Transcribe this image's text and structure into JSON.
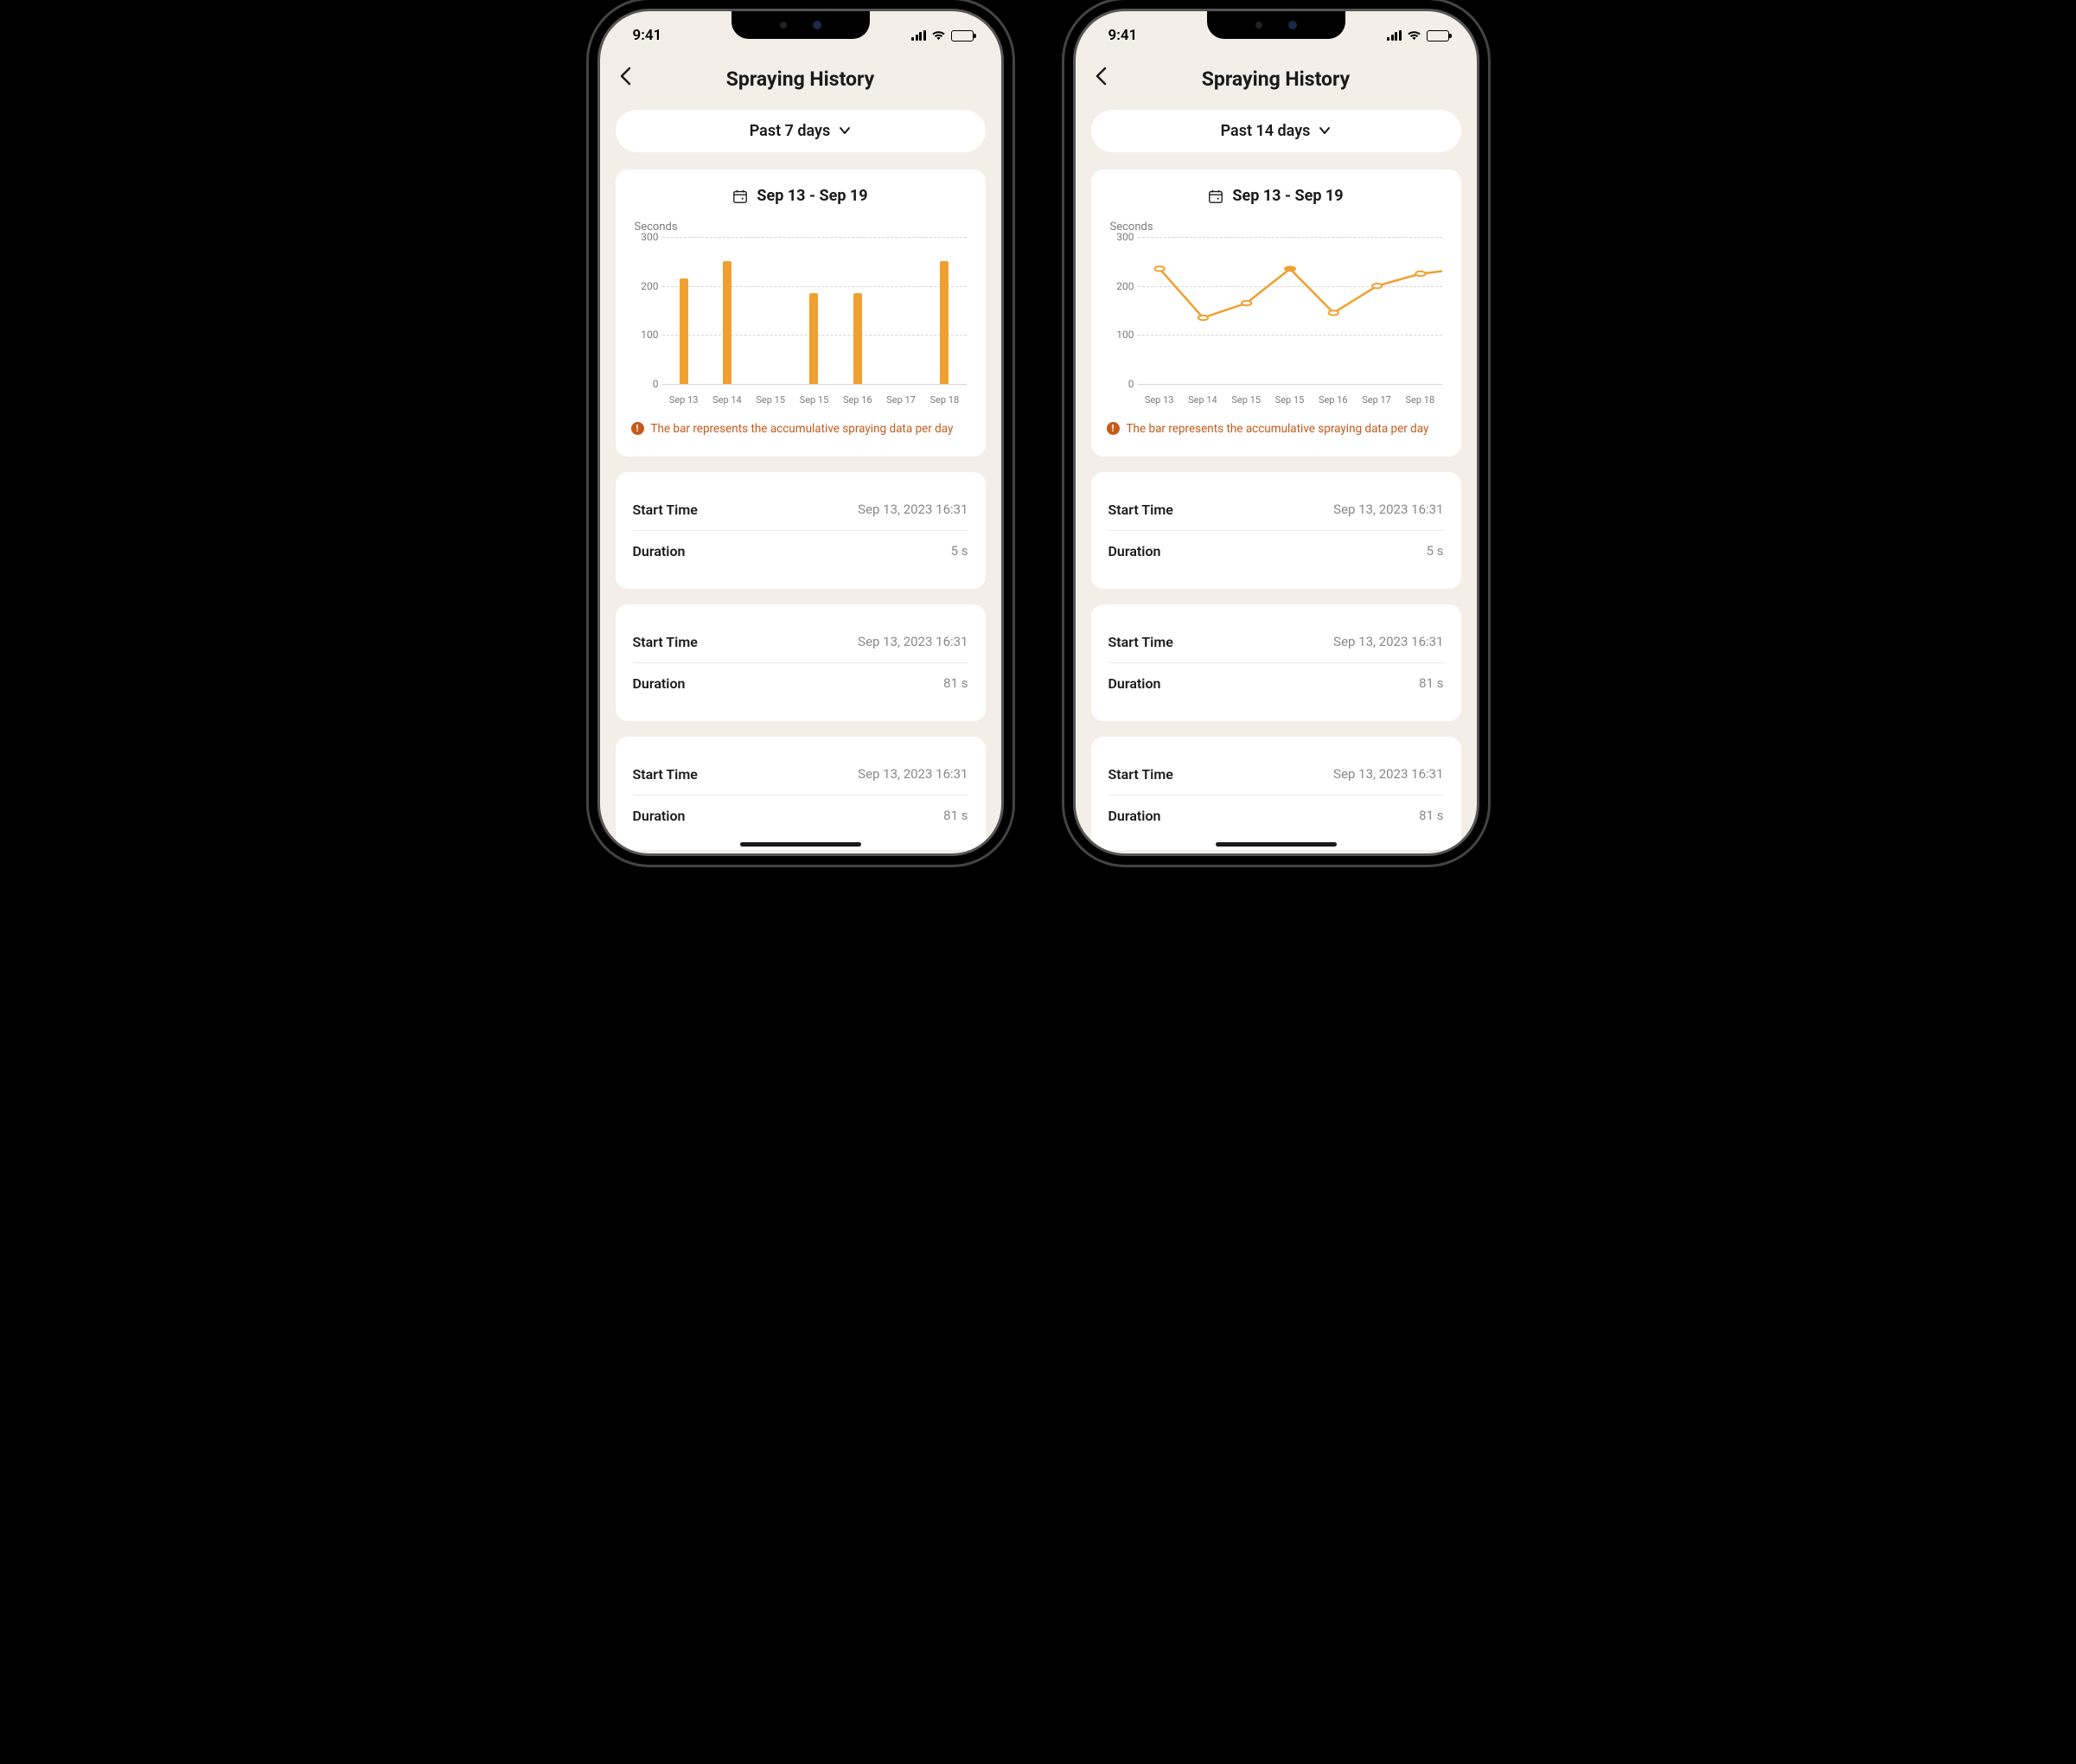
{
  "status": {
    "time": "9:41"
  },
  "header": {
    "title": "Spraying History"
  },
  "screens": [
    {
      "dropdown": "Past 7 days"
    },
    {
      "dropdown": "Past 14 days"
    }
  ],
  "chart_range": "Sep 13 - Sep 19",
  "chart_ylabel": "Seconds",
  "chart_note": "The bar represents the accumulative spraying data per day",
  "chart_data": [
    {
      "type": "bar",
      "title": "Sep 13 - Sep 19",
      "ylabel": "Seconds",
      "ylim": [
        0,
        300
      ],
      "yticks": [
        0,
        100,
        200,
        300
      ],
      "categories": [
        "Sep 13",
        "Sep 14",
        "Sep 15",
        "Sep 15",
        "Sep 16",
        "Sep 17",
        "Sep 18"
      ],
      "values": [
        215,
        250,
        0,
        185,
        185,
        0,
        250
      ]
    },
    {
      "type": "line",
      "title": "Sep 13 - Sep 19",
      "ylabel": "Seconds",
      "ylim": [
        0,
        300
      ],
      "yticks": [
        0,
        100,
        200,
        300
      ],
      "categories": [
        "Sep 13",
        "Sep 14",
        "Sep 15",
        "Sep 15",
        "Sep 16",
        "Sep 17",
        "Sep 18"
      ],
      "values": [
        235,
        135,
        165,
        235,
        145,
        200,
        225
      ],
      "filled_point_index": 3,
      "last_point_hollow": true,
      "extend_to": 230
    }
  ],
  "entries": [
    {
      "start_label": "Start Time",
      "start_value": "Sep 13, 2023 16:31",
      "dur_label": "Duration",
      "dur_value": "5 s"
    },
    {
      "start_label": "Start Time",
      "start_value": "Sep 13, 2023 16:31",
      "dur_label": "Duration",
      "dur_value": "81 s"
    },
    {
      "start_label": "Start Time",
      "start_value": "Sep 13, 2023 16:31",
      "dur_label": "Duration",
      "dur_value": "81 s"
    }
  ]
}
